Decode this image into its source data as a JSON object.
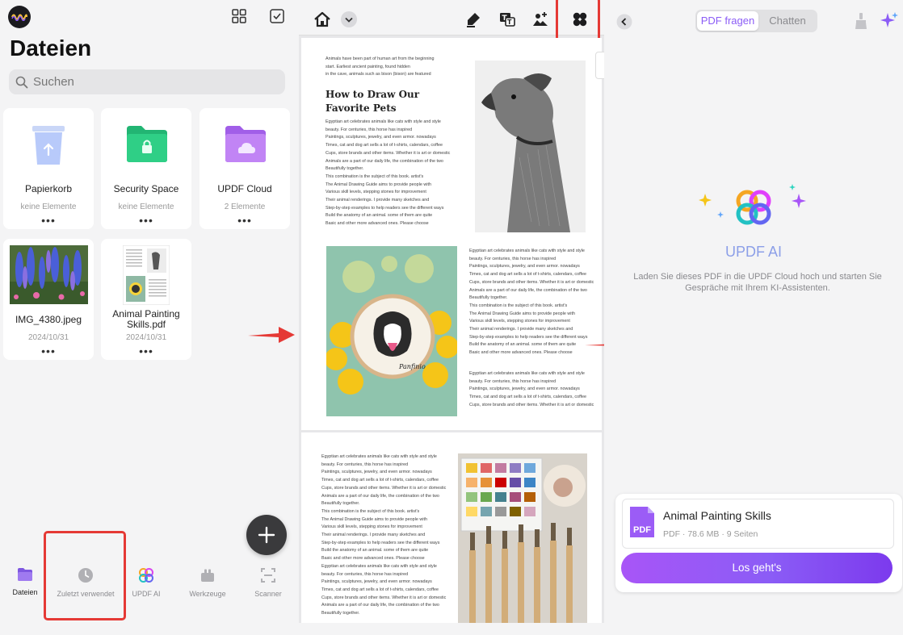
{
  "left": {
    "title": "Dateien",
    "search": {
      "placeholder": "Suchen"
    },
    "cards": [
      {
        "name": "Papierkorb",
        "sub": "keine Elemente",
        "more": "•••"
      },
      {
        "name": "Security Space",
        "sub": "keine Elemente",
        "more": "•••"
      },
      {
        "name": "UPDF Cloud",
        "sub": "2 Elemente",
        "more": "•••"
      },
      {
        "name": "IMG_4380.jpeg",
        "sub": "2024/10/31",
        "more": "•••"
      },
      {
        "name": "Animal Painting\nSkills.pdf",
        "sub": "2024/10/31",
        "more": "•••"
      }
    ],
    "tabs": [
      {
        "label": "Dateien"
      },
      {
        "label": "Zuletzt verwendet"
      },
      {
        "label": "UPDF AI"
      },
      {
        "label": "Werkzeuge"
      },
      {
        "label": "Scanner"
      }
    ]
  },
  "document": {
    "page1": {
      "intro": "Animals have been part of human art from the beginning\nstart. Earliest ancient painting, found hidden\nin the cave, animals such as bison (bison) are featured",
      "heading": "How to Draw Our\nFavorite Pets",
      "body1": "Egyptian art celebrates animals like cats with style and style\nbeauty. For centuries, this horse has inspired\nPaintings, sculptures, jewelry, and even armor. nowadays\nTimes, cat and dog art sells a lot of t-shirts, calendars, coffee\nCups, store brands and other items. Whether it is art or domestic\nAnimals are a part of our daily life, the combination of the two\nBeautifully together.\nThis combination is the subject of this book. artist's\nThe Animal Drawing Guide aims to provide people with\nVarious skill levels, stepping stones for improvement\nTheir animal renderings. I provide many sketches and\nStep-by-step examples to help readers see the different ways\nBuild the anatomy of an animal. some of them are quite\nBasic and other more advanced ones. Please choose",
      "body2": "Egyptian art celebrates animals like cats with style and style\nbeauty. For centuries, this horse has inspired\nPaintings, sculptures, jewelry, and even armor. nowadays\nTimes, cat and dog art sells a lot of t-shirts, calendars, coffee\nCups, store brands and other items. Whether it is art or domestic\nAnimals are a part of our daily life, the combination of the two\nBeautifully together.\nThis combination is the subject of this book. artist's\nThe Animal Drawing Guide aims to provide people with\nVarious skill levels, stepping stones for improvement\nTheir animal renderings. I provide many sketches and\nStep-by-step examples to help readers see the different ways\nBuild the anatomy of an animal. some of them are quite\nBasic and other more advanced ones. Please choose",
      "body3": "Egyptian art celebrates animals like cats with style and style\nbeauty. For centuries, this horse has inspired\nPaintings, sculptures, jewelry, and even armor. nowadays\nTimes, cat and dog art sells a lot of t-shirts, calendars, coffee\nCups, store brands and other items. Whether it is art or domestic",
      "hoop_text": "Panfinio"
    },
    "page2": {
      "body": "Egyptian art celebrates animals like cats with style and style\nbeauty. For centuries, this horse has inspired\nPaintings, sculptures, jewelry, and even armor. nowadays\nTimes, cat and dog art sells a lot of t-shirts, calendars, coffee\nCups, store brands and other items. Whether it is art or domestic\nAnimals are a part of our daily life, the combination of the two\nBeautifully together.\nThis combination is the subject of this book. artist's\nThe Animal Drawing Guide aims to provide people with\nVarious skill levels, stepping stones for improvement\nTheir animal renderings. I provide many sketches and\nStep-by-step examples to help readers see the different ways\nBuild the anatomy of an animal. some of them are quite\nBasic and other more advanced ones. Please choose\nEgyptian art celebrates animals like cats with style and style\nbeauty. For centuries, this horse has inspired\nPaintings, sculptures, jewelry, and even armor. nowadays\nTimes, cat and dog art sells a lot of t-shirts, calendars, coffee\nCups, store brands and other items. Whether it is art or domestic\nAnimals are a part of our daily life, the combination of the two\nBeautifully together."
    }
  },
  "right": {
    "segments": {
      "ask": "PDF fragen",
      "chat": "Chatten",
      "active": "ask"
    },
    "ai_title": "UPDF AI",
    "ai_description": "Laden Sie dieses PDF in die UPDF Cloud hoch und starten Sie Gespräche mit Ihrem KI-Assistenten.",
    "file": {
      "icon_label": "PDF",
      "name": "Animal Painting Skills",
      "meta": "PDF · 78.6 MB · 9 Seiten"
    },
    "go_button": "Los geht's"
  },
  "colors": {
    "accent_purple": "#8b5cf6",
    "highlight_red": "#e53935",
    "ai_title": "#8c9fe8"
  }
}
